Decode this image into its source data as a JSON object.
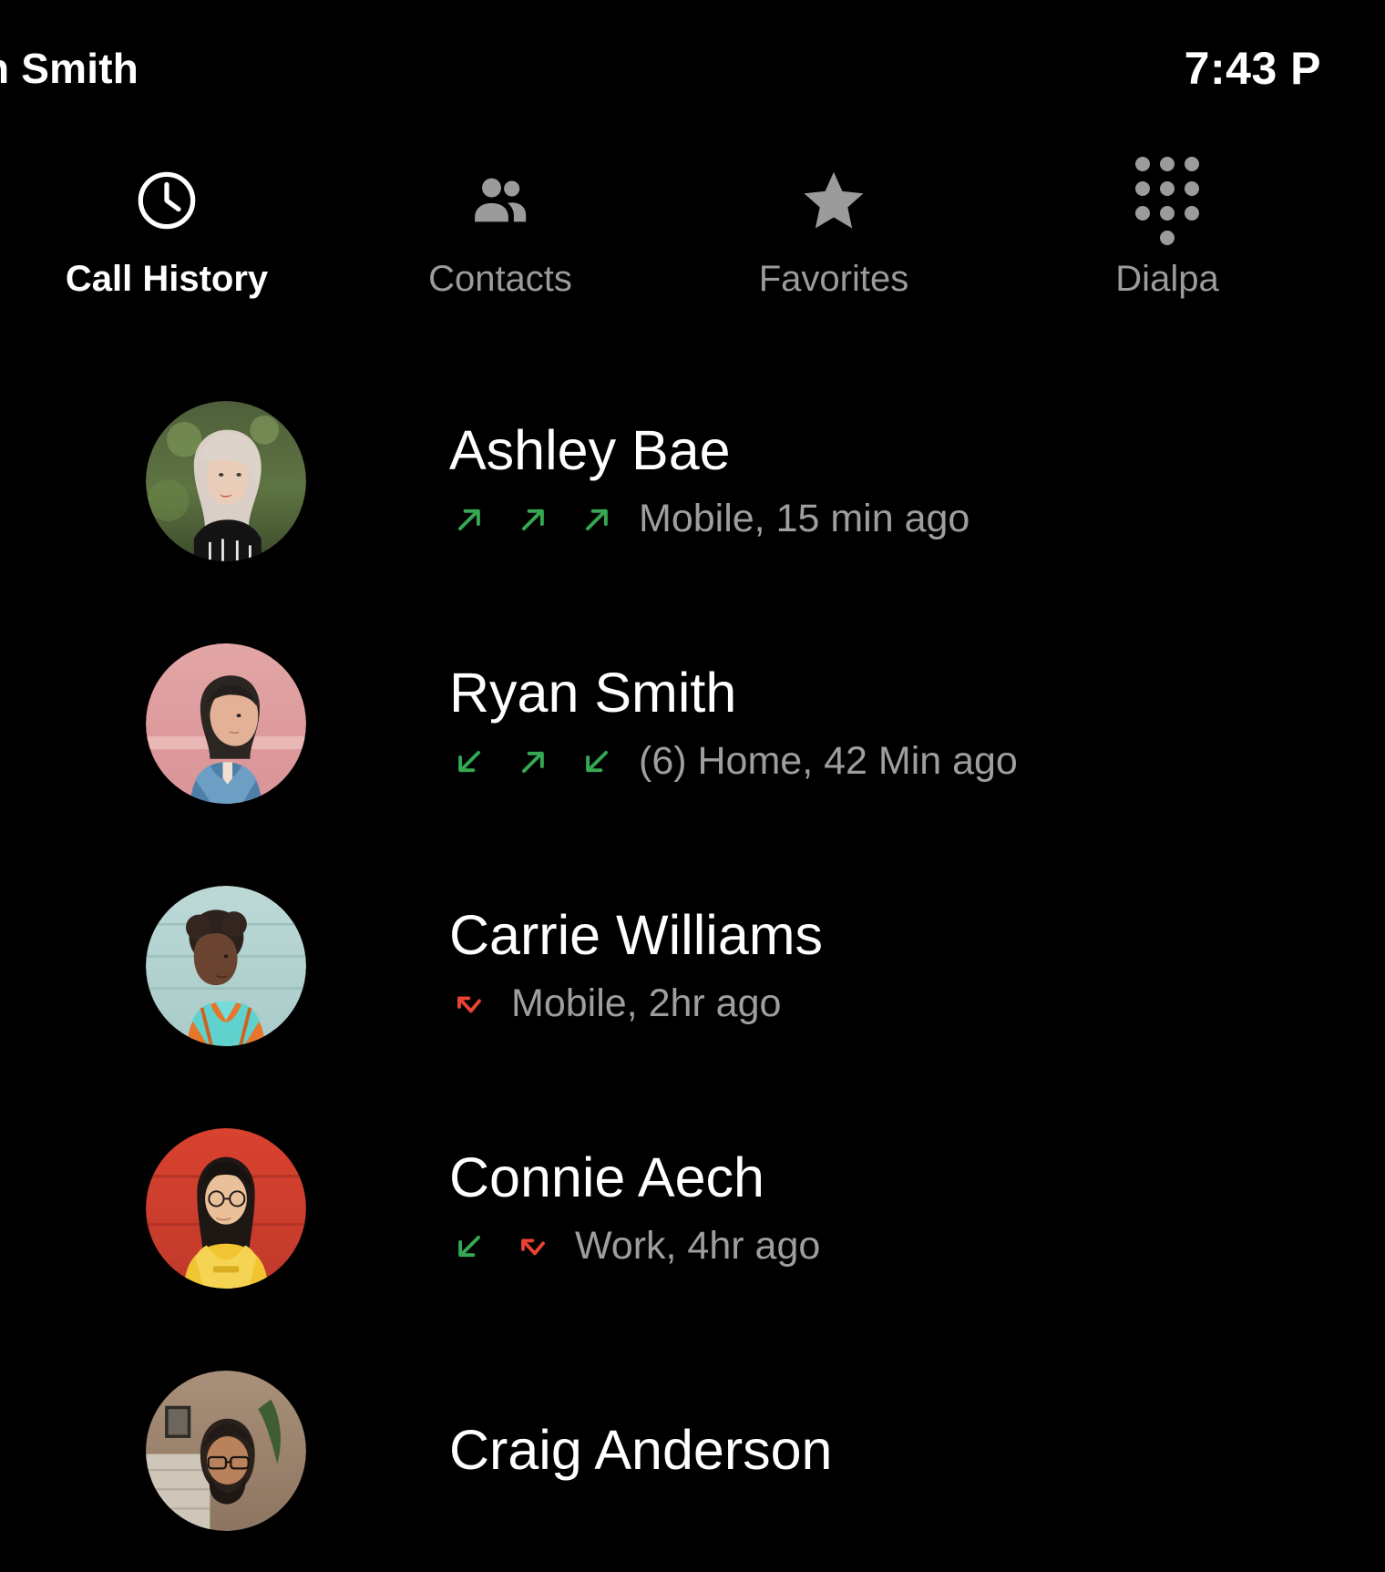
{
  "status_bar": {
    "title": "n Smith",
    "time": "7:43 P"
  },
  "tabs": [
    {
      "label": "Call History",
      "icon": "clock-icon",
      "active": true
    },
    {
      "label": "Contacts",
      "icon": "people-icon",
      "active": false
    },
    {
      "label": "Favorites",
      "icon": "star-icon",
      "active": false
    },
    {
      "label": "Dialpa",
      "icon": "dialpad-icon",
      "active": false
    }
  ],
  "colors": {
    "background": "#000000",
    "active_tab": "#ffffff",
    "inactive_tab": "#9b9b9b",
    "subtitle": "#9e9e9e",
    "incoming_outgoing": "#35a853",
    "missed": "#ea4335"
  },
  "calls": [
    {
      "name": "Ashley Bae",
      "arrows": [
        "outgoing",
        "outgoing",
        "outgoing"
      ],
      "detail": "Mobile, 15 min ago",
      "avatar": "ashley-bae-avatar"
    },
    {
      "name": "Ryan Smith",
      "arrows": [
        "incoming",
        "outgoing",
        "incoming"
      ],
      "detail": "(6) Home, 42 Min ago",
      "avatar": "ryan-smith-avatar"
    },
    {
      "name": "Carrie Williams",
      "arrows": [
        "missed"
      ],
      "detail": "Mobile, 2hr ago",
      "avatar": "carrie-williams-avatar"
    },
    {
      "name": "Connie Aech",
      "arrows": [
        "incoming",
        "missed"
      ],
      "detail": "Work, 4hr ago",
      "avatar": "connie-aech-avatar"
    },
    {
      "name": "Craig Anderson",
      "arrows": [],
      "detail": "",
      "avatar": "craig-anderson-avatar"
    }
  ]
}
